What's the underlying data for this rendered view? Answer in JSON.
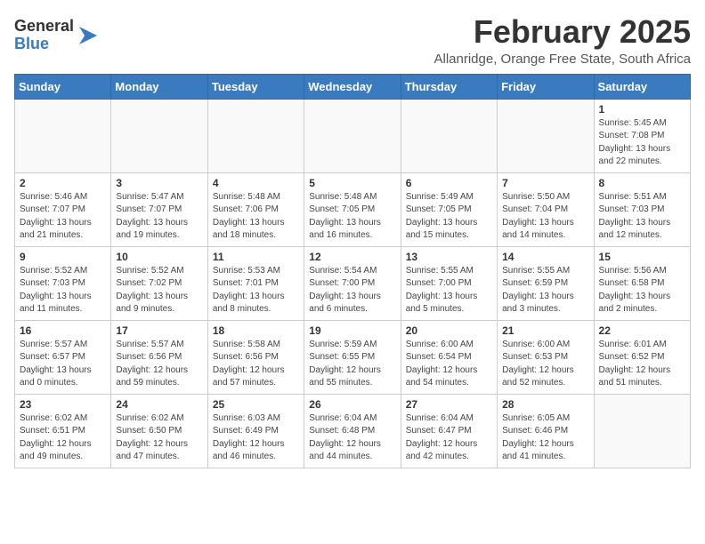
{
  "logo": {
    "general": "General",
    "blue": "Blue"
  },
  "title": "February 2025",
  "location": "Allanridge, Orange Free State, South Africa",
  "days_of_week": [
    "Sunday",
    "Monday",
    "Tuesday",
    "Wednesday",
    "Thursday",
    "Friday",
    "Saturday"
  ],
  "weeks": [
    [
      {
        "day": "",
        "info": ""
      },
      {
        "day": "",
        "info": ""
      },
      {
        "day": "",
        "info": ""
      },
      {
        "day": "",
        "info": ""
      },
      {
        "day": "",
        "info": ""
      },
      {
        "day": "",
        "info": ""
      },
      {
        "day": "1",
        "info": "Sunrise: 5:45 AM\nSunset: 7:08 PM\nDaylight: 13 hours\nand 22 minutes."
      }
    ],
    [
      {
        "day": "2",
        "info": "Sunrise: 5:46 AM\nSunset: 7:07 PM\nDaylight: 13 hours\nand 21 minutes."
      },
      {
        "day": "3",
        "info": "Sunrise: 5:47 AM\nSunset: 7:07 PM\nDaylight: 13 hours\nand 19 minutes."
      },
      {
        "day": "4",
        "info": "Sunrise: 5:48 AM\nSunset: 7:06 PM\nDaylight: 13 hours\nand 18 minutes."
      },
      {
        "day": "5",
        "info": "Sunrise: 5:48 AM\nSunset: 7:05 PM\nDaylight: 13 hours\nand 16 minutes."
      },
      {
        "day": "6",
        "info": "Sunrise: 5:49 AM\nSunset: 7:05 PM\nDaylight: 13 hours\nand 15 minutes."
      },
      {
        "day": "7",
        "info": "Sunrise: 5:50 AM\nSunset: 7:04 PM\nDaylight: 13 hours\nand 14 minutes."
      },
      {
        "day": "8",
        "info": "Sunrise: 5:51 AM\nSunset: 7:03 PM\nDaylight: 13 hours\nand 12 minutes."
      }
    ],
    [
      {
        "day": "9",
        "info": "Sunrise: 5:52 AM\nSunset: 7:03 PM\nDaylight: 13 hours\nand 11 minutes."
      },
      {
        "day": "10",
        "info": "Sunrise: 5:52 AM\nSunset: 7:02 PM\nDaylight: 13 hours\nand 9 minutes."
      },
      {
        "day": "11",
        "info": "Sunrise: 5:53 AM\nSunset: 7:01 PM\nDaylight: 13 hours\nand 8 minutes."
      },
      {
        "day": "12",
        "info": "Sunrise: 5:54 AM\nSunset: 7:00 PM\nDaylight: 13 hours\nand 6 minutes."
      },
      {
        "day": "13",
        "info": "Sunrise: 5:55 AM\nSunset: 7:00 PM\nDaylight: 13 hours\nand 5 minutes."
      },
      {
        "day": "14",
        "info": "Sunrise: 5:55 AM\nSunset: 6:59 PM\nDaylight: 13 hours\nand 3 minutes."
      },
      {
        "day": "15",
        "info": "Sunrise: 5:56 AM\nSunset: 6:58 PM\nDaylight: 13 hours\nand 2 minutes."
      }
    ],
    [
      {
        "day": "16",
        "info": "Sunrise: 5:57 AM\nSunset: 6:57 PM\nDaylight: 13 hours\nand 0 minutes."
      },
      {
        "day": "17",
        "info": "Sunrise: 5:57 AM\nSunset: 6:56 PM\nDaylight: 12 hours\nand 59 minutes."
      },
      {
        "day": "18",
        "info": "Sunrise: 5:58 AM\nSunset: 6:56 PM\nDaylight: 12 hours\nand 57 minutes."
      },
      {
        "day": "19",
        "info": "Sunrise: 5:59 AM\nSunset: 6:55 PM\nDaylight: 12 hours\nand 55 minutes."
      },
      {
        "day": "20",
        "info": "Sunrise: 6:00 AM\nSunset: 6:54 PM\nDaylight: 12 hours\nand 54 minutes."
      },
      {
        "day": "21",
        "info": "Sunrise: 6:00 AM\nSunset: 6:53 PM\nDaylight: 12 hours\nand 52 minutes."
      },
      {
        "day": "22",
        "info": "Sunrise: 6:01 AM\nSunset: 6:52 PM\nDaylight: 12 hours\nand 51 minutes."
      }
    ],
    [
      {
        "day": "23",
        "info": "Sunrise: 6:02 AM\nSunset: 6:51 PM\nDaylight: 12 hours\nand 49 minutes."
      },
      {
        "day": "24",
        "info": "Sunrise: 6:02 AM\nSunset: 6:50 PM\nDaylight: 12 hours\nand 47 minutes."
      },
      {
        "day": "25",
        "info": "Sunrise: 6:03 AM\nSunset: 6:49 PM\nDaylight: 12 hours\nand 46 minutes."
      },
      {
        "day": "26",
        "info": "Sunrise: 6:04 AM\nSunset: 6:48 PM\nDaylight: 12 hours\nand 44 minutes."
      },
      {
        "day": "27",
        "info": "Sunrise: 6:04 AM\nSunset: 6:47 PM\nDaylight: 12 hours\nand 42 minutes."
      },
      {
        "day": "28",
        "info": "Sunrise: 6:05 AM\nSunset: 6:46 PM\nDaylight: 12 hours\nand 41 minutes."
      },
      {
        "day": "",
        "info": ""
      }
    ]
  ]
}
